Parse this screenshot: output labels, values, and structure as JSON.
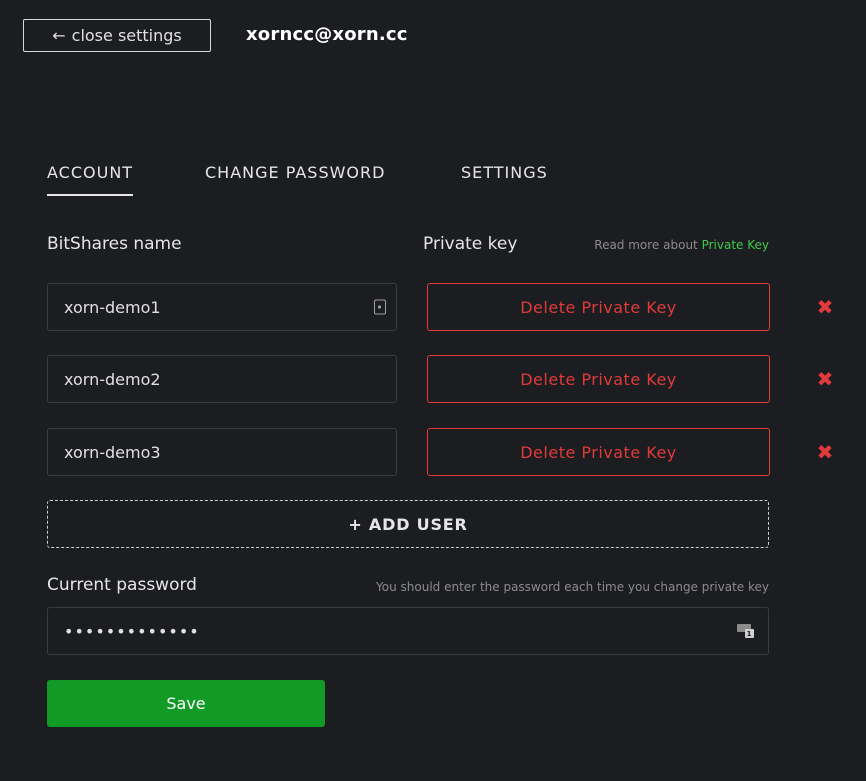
{
  "header": {
    "close_label": "close settings",
    "close_arrow": "←",
    "user_email": "xorncc@xorn.cc"
  },
  "tabs": [
    {
      "label": "ACCOUNT",
      "active": true
    },
    {
      "label": "CHANGE PASSWORD",
      "active": false
    },
    {
      "label": "SETTINGS",
      "active": false
    }
  ],
  "accounts": {
    "name_column_label": "BitShares name",
    "key_column_label": "Private key",
    "read_more_prefix": "Read more about",
    "read_more_link": "Private Key",
    "rows": [
      {
        "name": "xorn-demo1",
        "action": "Delete Private Key"
      },
      {
        "name": "xorn-demo2",
        "action": "Delete Private Key"
      },
      {
        "name": "xorn-demo3",
        "action": "Delete Private Key"
      }
    ],
    "remove_glyph": "✖",
    "add_user_label": "+ ADD USER"
  },
  "password": {
    "label": "Current password",
    "hint": "You should enter the password each time you change private key",
    "value_masked": "•••••••••••••"
  },
  "save_label": "Save",
  "colors": {
    "background": "#1c1d21",
    "danger": "#e03a3a",
    "success": "#129a27",
    "link": "#3fc94a"
  },
  "icons": {
    "field_icon": "key-card-icon",
    "password_icon": "password-manager-icon"
  }
}
